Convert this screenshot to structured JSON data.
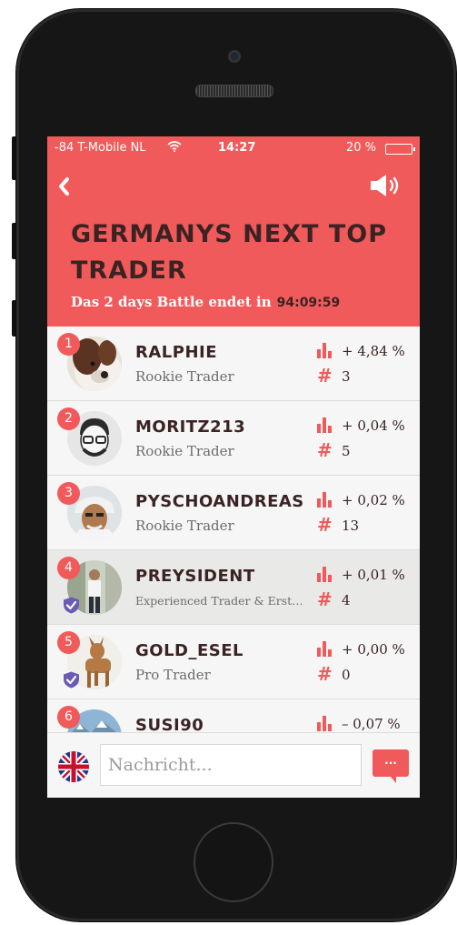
{
  "status_bar": {
    "carrier": "-84 T-Mobile NL",
    "time": "14:27",
    "battery": "20 %"
  },
  "header": {
    "title": "GERMANYS NEXT TOP TRADER",
    "countdown_label": "Das 2 days Battle endet in",
    "countdown_time": "94:09:59"
  },
  "leaderboard": [
    {
      "rank": "1",
      "name": "RALPHIE",
      "level": "Rookie Trader",
      "change": "+ 4,84 %",
      "position": "3",
      "badge": false
    },
    {
      "rank": "2",
      "name": "MORITZ213",
      "level": "Rookie Trader",
      "change": "+ 0,04 %",
      "position": "5",
      "badge": false
    },
    {
      "rank": "3",
      "name": "PYSCHOANDREAS",
      "level": "Rookie Trader",
      "change": "+ 0,02 %",
      "position": "13",
      "badge": false
    },
    {
      "rank": "4",
      "name": "PREYSIDENT",
      "level": "Experienced Trader & Erste...",
      "change": "+ 0,01 %",
      "position": "4",
      "badge": true
    },
    {
      "rank": "5",
      "name": "GOLD_ESEL",
      "level": "Pro Trader",
      "change": "+ 0,00 %",
      "position": "0",
      "badge": true
    },
    {
      "rank": "6",
      "name": "SUSI90",
      "level": "",
      "change": "– 0,07 %",
      "position": "",
      "badge": false
    }
  ],
  "footer": {
    "message_placeholder": "Nachricht...",
    "send_label": "..."
  },
  "colors": {
    "accent": "#f15a5a",
    "title_text": "#3b2323",
    "badge": "#6b5bb5"
  },
  "icons": {
    "back": "chevron-left-icon",
    "sound": "speaker-icon",
    "performance": "bar-chart-icon",
    "position": "hash-icon",
    "language": "uk-flag-icon",
    "send": "chat-bubble-icon",
    "verified": "shield-check-icon"
  }
}
